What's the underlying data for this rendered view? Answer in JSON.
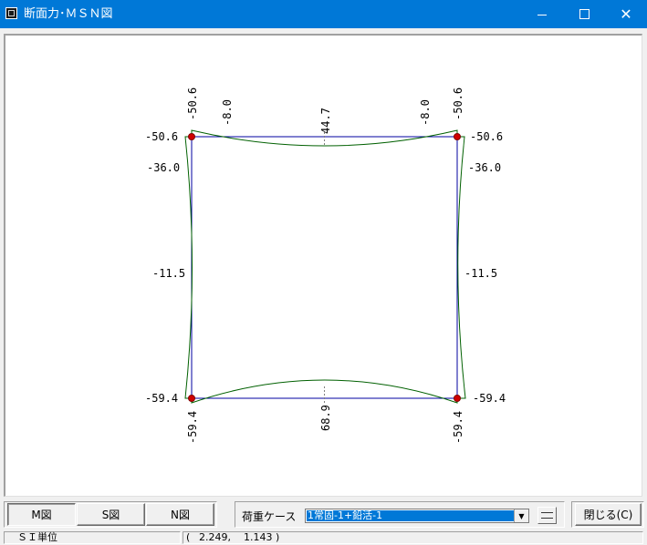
{
  "window": {
    "title": "断面力･ＭＳＮ図",
    "icon": "app-icon",
    "controls": [
      "minimize",
      "maximize",
      "close"
    ]
  },
  "diagram": {
    "labels": {
      "top_left_vertical": "-50.6",
      "top_left_horizontal": "-50.6",
      "top_left_inner": "-8.0",
      "top_center": "44.7",
      "top_right_inner": "-8.0",
      "top_right_vertical": "-50.6",
      "top_right_horizontal": "-50.6",
      "left_upper": "-36.0",
      "right_upper": "-36.0",
      "left_mid": "-11.5",
      "right_mid": "-11.5",
      "bottom_left_horizontal": "-59.4",
      "bottom_right_horizontal": "-59.4",
      "bottom_left_vertical": "-59.4",
      "bottom_center": "68.9",
      "bottom_right_vertical": "-59.4"
    },
    "colors": {
      "frame": "#0000a0",
      "moment_curve": "#006000",
      "node": "#d00000"
    }
  },
  "toolbar": {
    "m_button": "M図",
    "s_button": "S図",
    "n_button": "N図",
    "load_case_label": "荷重ケース",
    "load_case_value": "1常固-1+鉛活-1",
    "close_button": "閉じる(C)"
  },
  "statusbar": {
    "units": "ＳＩ単位",
    "coords_open": "(",
    "coords_value": "2.249,    1.143 )"
  }
}
